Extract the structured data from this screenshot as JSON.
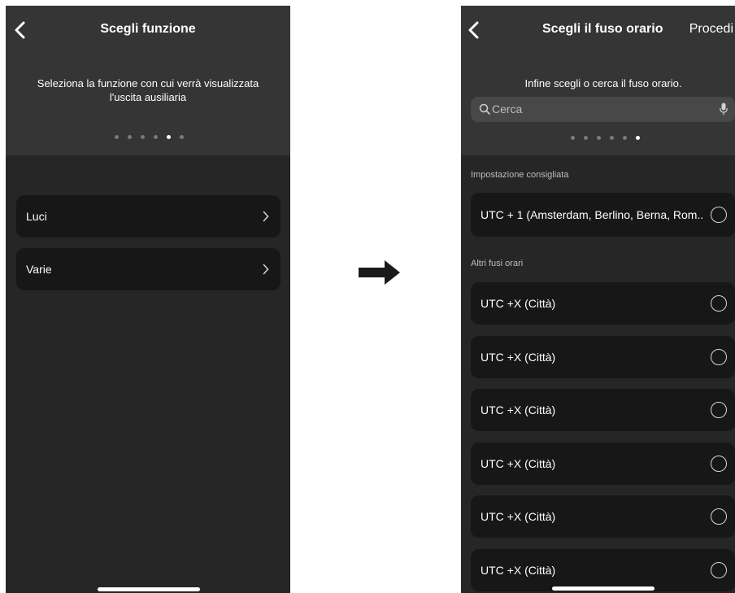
{
  "left": {
    "title": "Scegli funzione",
    "subtitle": "Seleziona la funzione con cui verrà visualizzata l'uscita ausiliaria",
    "dots_total": 6,
    "dots_active": 4,
    "items": [
      {
        "label": "Luci"
      },
      {
        "label": "Varie"
      }
    ]
  },
  "right": {
    "title": "Scegli il fuso orario",
    "proceed_label": "Procedi",
    "subtitle": "Infine scegli o cerca il fuso orario.",
    "search": {
      "placeholder": "Cerca"
    },
    "dots_total": 6,
    "dots_active": 5,
    "recommended_header": "Impostazione consigliata",
    "recommended_item": "UTC + 1 (Amsterdam, Berlino, Berna, Rom..",
    "other_header": "Altri fusi orari",
    "other_items": [
      "UTC +X (Città)",
      "UTC +X (Città)",
      "UTC +X (Città)",
      "UTC +X (Città)",
      "UTC +X (Città)",
      "UTC +X (Città)"
    ]
  },
  "icons": {
    "back": "chevron-left-icon",
    "row_chevron": "chevron-right-icon",
    "search": "search-icon",
    "mic": "microphone-icon",
    "arrow": "right-arrow-icon"
  },
  "colors": {
    "background": "#262626",
    "header": "#353535",
    "row": "#171717",
    "search_field": "#484848"
  }
}
